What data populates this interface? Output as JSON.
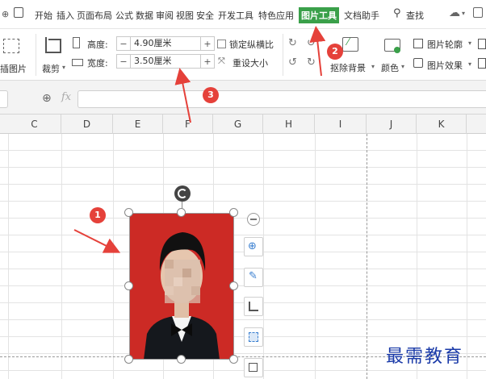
{
  "menubar": {
    "items": [
      "开始",
      "插入",
      "页面布局",
      "公式",
      "数据",
      "审阅",
      "视图",
      "安全",
      "开发工具",
      "特色应用",
      "图片工具",
      "文档助手"
    ],
    "search_label": "查找"
  },
  "ribbon": {
    "insert_picture_label": "插图片",
    "crop_label": "裁剪",
    "height_label": "高度:",
    "height_value": "4.90厘米",
    "width_label": "宽度:",
    "width_value": "3.50厘米",
    "lock_ratio_label": "锁定纵横比",
    "reset_size_label": "重设大小",
    "remove_bg_label": "抠除背景",
    "color_label": "颜色",
    "outline_label": "图片轮廓",
    "effects_label": "图片效果",
    "minus": "−",
    "plus": "+"
  },
  "formula_bar": {
    "fx_label": "fx",
    "value": ""
  },
  "columns": [
    "C",
    "D",
    "E",
    "F",
    "G",
    "H",
    "I",
    "J",
    "K"
  ],
  "annotations": [
    "1",
    "2",
    "3"
  ],
  "watermark": "最需教育",
  "colors": {
    "accent": "#3aa04a",
    "photo_bg": "#cc2a25",
    "badge": "#e5413a",
    "arrow": "#e5413a",
    "watermark": "#1a3aa8"
  }
}
